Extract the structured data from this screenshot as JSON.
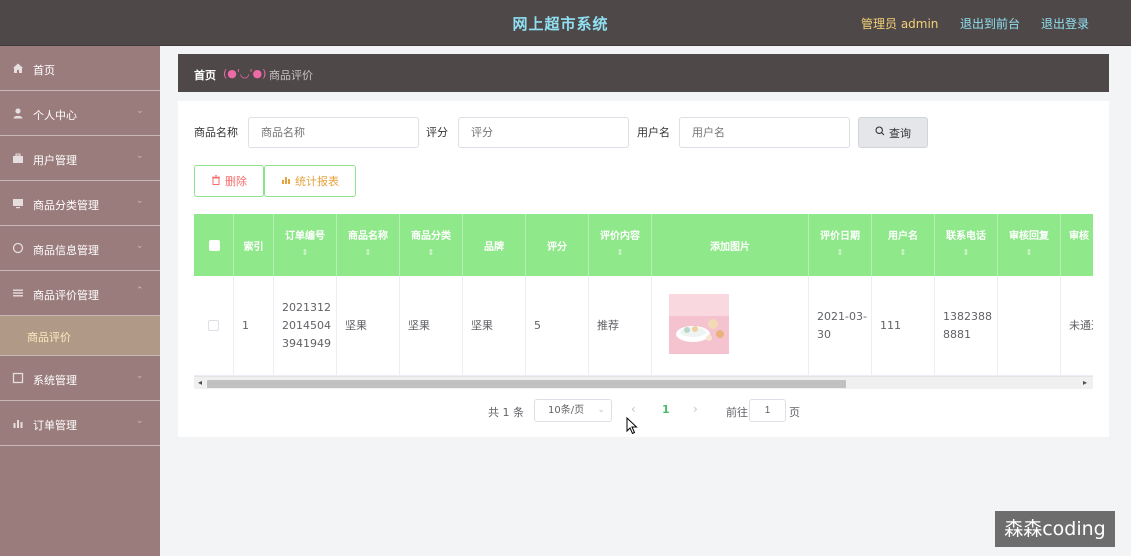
{
  "header": {
    "title": "网上超市系统",
    "admin_label": "管理员 admin",
    "to_front_label": "退出到前台",
    "logout_label": "退出登录"
  },
  "sidebar": {
    "items": [
      {
        "label": "首页",
        "icon": "home-icon"
      },
      {
        "label": "个人中心",
        "icon": "user-icon"
      },
      {
        "label": "用户管理",
        "icon": "briefcase-icon"
      },
      {
        "label": "商品分类管理",
        "icon": "monitor-icon"
      },
      {
        "label": "商品信息管理",
        "icon": "circle-icon"
      },
      {
        "label": "商品评价管理",
        "icon": "list-icon"
      }
    ],
    "sub_item": {
      "label": "商品评价"
    },
    "items_after": [
      {
        "label": "系统管理",
        "icon": "square-icon"
      },
      {
        "label": "订单管理",
        "icon": "bar-chart-icon"
      }
    ]
  },
  "breadcrumb": {
    "home": "首页",
    "separator": "(●'◡'●)",
    "current": "商品评价"
  },
  "search": {
    "product_name_label": "商品名称",
    "product_name_placeholder": "商品名称",
    "rating_label": "评分",
    "rating_placeholder": "评分",
    "username_label": "用户名",
    "username_placeholder": "用户名",
    "query_label": "查询"
  },
  "actions": {
    "delete_label": "删除",
    "stats_label": "统计报表"
  },
  "table": {
    "columns": [
      "索引",
      "订单编号",
      "商品名称",
      "商品分类",
      "品牌",
      "评分",
      "评价内容",
      "添加图片",
      "评价日期",
      "用户名",
      "联系电话",
      "审核回复",
      "审核"
    ],
    "rows": [
      {
        "index": "1",
        "order_no": "202131220145043941949",
        "product_name": "坚果",
        "category": "坚果",
        "brand": "坚果",
        "rating": "5",
        "content": "推荐",
        "date": "2021-03-30",
        "username": "111",
        "phone": "13823888881",
        "reply": "",
        "audit": "未通过"
      }
    ]
  },
  "pagination": {
    "total": "共 1 条",
    "page_size": "10条/页",
    "current_page": "1",
    "goto_label": "前往",
    "goto_value": "1",
    "page_unit": "页"
  },
  "watermark": "森森coding",
  "colors": {
    "header_bg": "#4f4848",
    "sidebar_bg": "#9b7c7c",
    "table_header_bg": "#8fe88a",
    "title_color": "#8fe0f2",
    "admin_color": "#f2d078"
  }
}
